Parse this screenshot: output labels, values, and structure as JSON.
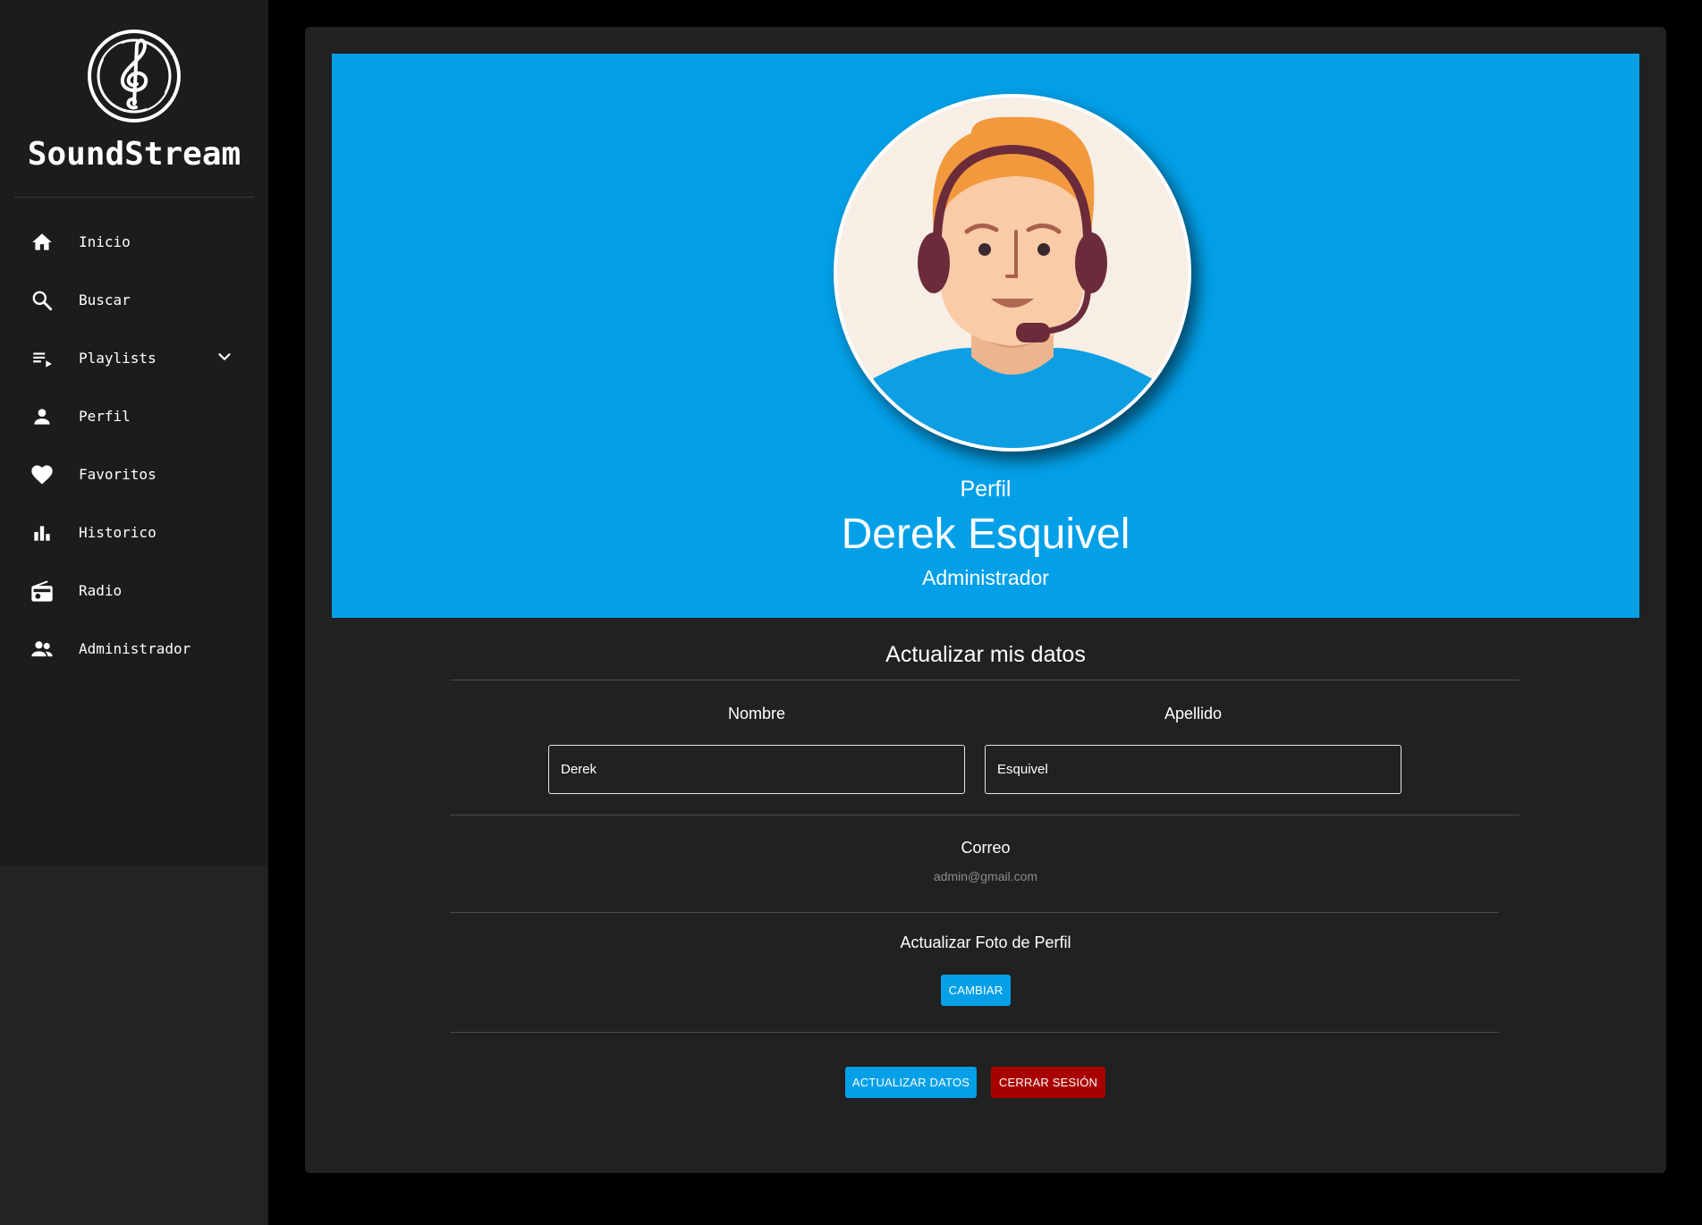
{
  "app": {
    "name": "SoundStream"
  },
  "sidebar": {
    "items": [
      {
        "label": "Inicio",
        "icon": "home-icon"
      },
      {
        "label": "Buscar",
        "icon": "search-icon"
      },
      {
        "label": "Playlists",
        "icon": "playlist-icon",
        "expandable": true
      },
      {
        "label": "Perfil",
        "icon": "person-icon"
      },
      {
        "label": "Favoritos",
        "icon": "heart-icon"
      },
      {
        "label": "Historico",
        "icon": "bar-chart-icon"
      },
      {
        "label": "Radio",
        "icon": "radio-icon"
      },
      {
        "label": "Administrador",
        "icon": "people-icon"
      }
    ]
  },
  "profile": {
    "subtitle": "Perfil",
    "name": "Derek Esquivel",
    "role": "Administrador"
  },
  "form": {
    "title": "Actualizar mis datos",
    "first_name_label": "Nombre",
    "first_name_value": "Derek",
    "last_name_label": "Apellido",
    "last_name_value": "Esquivel",
    "email_label": "Correo",
    "email_value": "admin@gmail.com",
    "photo_label": "Actualizar Foto de Perfil",
    "change_button": "CAMBIAR",
    "update_button": "ACTUALIZAR DATOS",
    "logout_button": "CERRAR SESIÓN"
  },
  "colors": {
    "accent": "#03a0e8",
    "danger": "#a80000",
    "sidebar": "#1c1c1c",
    "card": "#212121"
  }
}
